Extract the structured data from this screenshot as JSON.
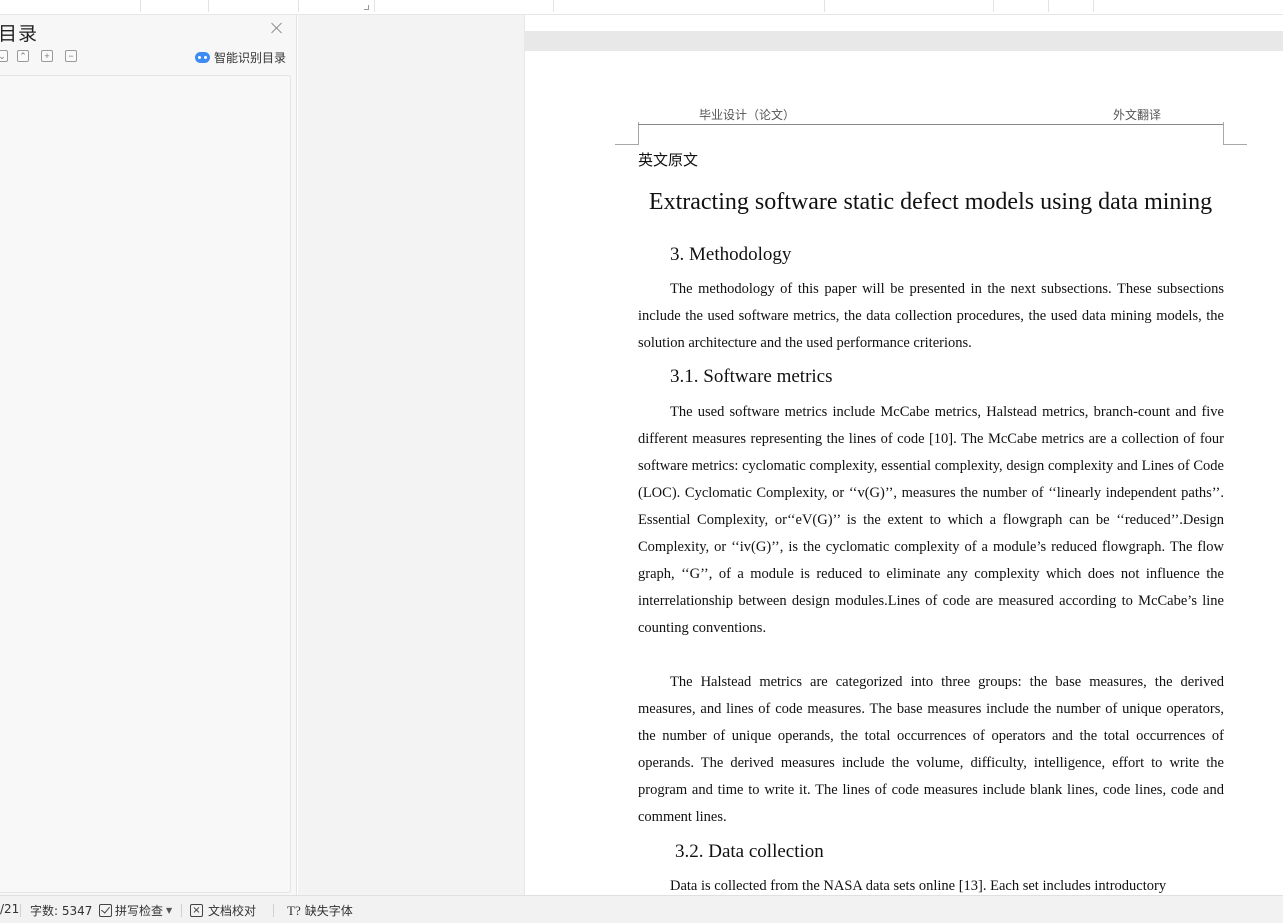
{
  "toc": {
    "title": "目录",
    "smart_toc_label": "智能识别目录"
  },
  "document": {
    "header_left": "毕业设计（论文）",
    "header_right": "外文翻译",
    "cn_title": "英文原文",
    "title": "Extracting software static defect models using data mining",
    "sec3_heading": "3. Methodology",
    "sec3_para": "The methodology of this paper will be presented in the next subsections. These subsections include the used software metrics, the data collection procedures, the used data mining models, the solution architecture and the used performance criterions.",
    "sec31_heading": "3.1. Software metrics",
    "sec31_para1": "The used software metrics include McCabe metrics, Halstead metrics, branch-count and five different measures representing the lines of code [10]. The McCabe metrics are a collection of four software metrics: cyclomatic complexity, essential complexity, design complexity and Lines of Code (LOC). Cyclomatic Complexity, or ‘‘v(G)’’, measures the number of ‘‘linearly independent paths’’. Essential Complexity, or‘‘eV(G)’’ is the extent to which a flowgraph can be ‘‘reduced’’.Design Complexity, or ‘‘iv(G)’’, is the cyclomatic complexity of a module’s reduced flowgraph. The flow graph, ‘‘G’’, of a module is reduced to eliminate any complexity which does not influence the interrelationship between design modules.Lines of code are measured according to McCabe’s line counting conventions.",
    "sec31_para2": "The Halstead metrics are categorized into three groups: the base measures, the derived measures, and lines of code measures. The base measures include the number of unique operators, the number of unique operands, the total occurrences of operators and the total occurrences of operands. The derived measures include the volume, difficulty, intelligence, effort to write the program and time to write it. The lines of code measures include blank lines, code lines, code and comment lines.",
    "sec32_heading": "3.2. Data collection",
    "sec32_para": "Data is collected from the NASA data sets online [13]. Each set includes introductory"
  },
  "status": {
    "page_fragment": "/21",
    "word_count": "字数: 5347",
    "spell_check": "拼写检查",
    "proofread": "文档校对",
    "missing_font": "缺失字体"
  },
  "colors": {
    "accent": "#3d8bf5",
    "workspace_bg": "#e8e8e8",
    "status_bg": "#f2f2f2"
  }
}
